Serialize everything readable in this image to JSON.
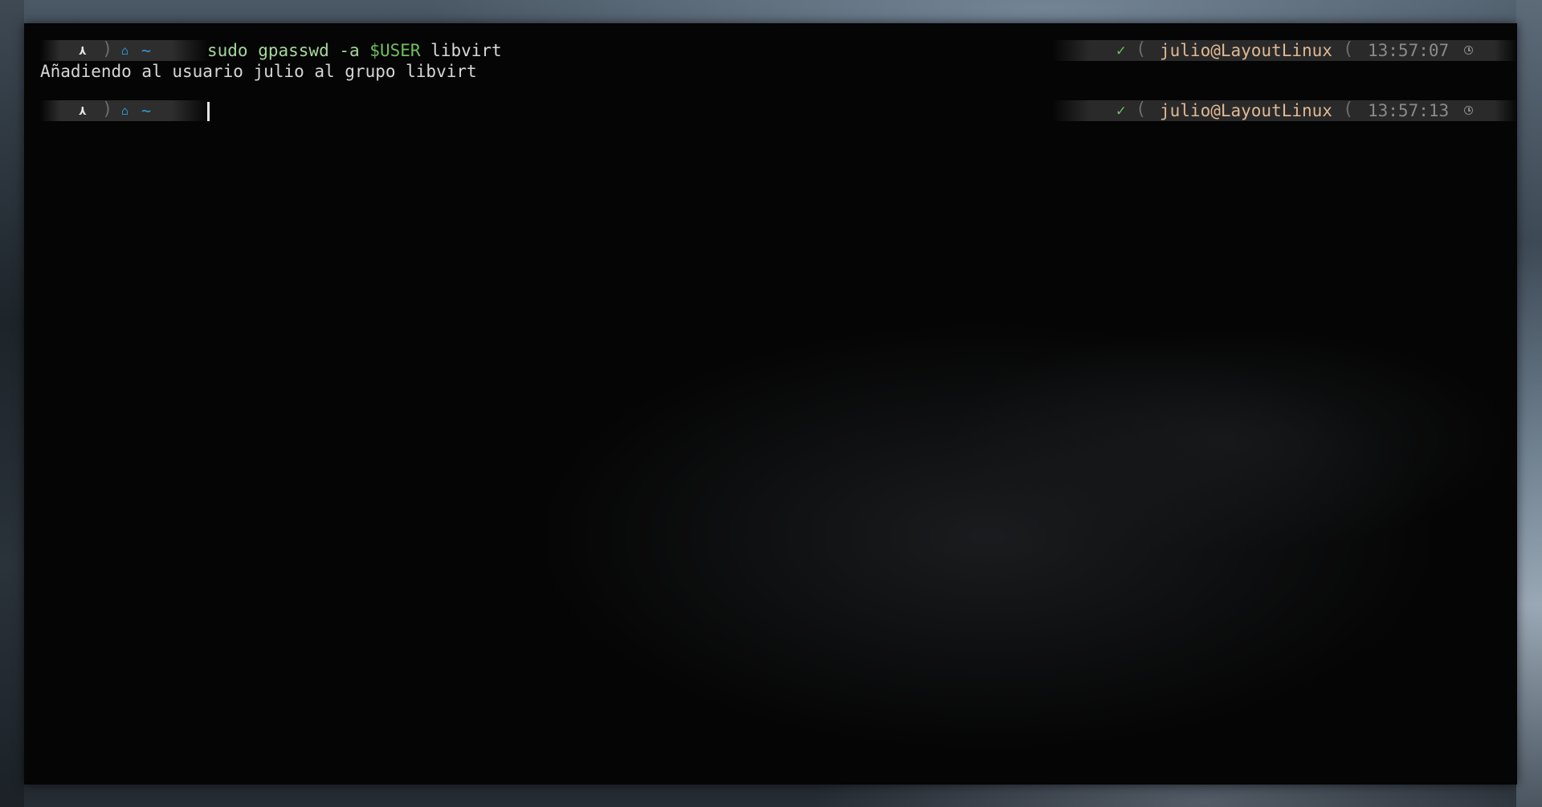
{
  "terminal": {
    "lines": [
      {
        "prompt": {
          "os_icon": "arch-icon",
          "os_glyph": "⋏",
          "separator": ")",
          "home_icon": "home-icon",
          "home_glyph": "⌂",
          "path": "~"
        },
        "command": {
          "name": "sudo gpasswd -a ",
          "variable": "$USER",
          "argument": " libvirt"
        },
        "right_prompt": {
          "status_icon": "check-icon",
          "status_glyph": "✓",
          "separator_open": "(",
          "user_host": "julio@LayoutLinux",
          "time": "13:57:07",
          "time_icon": "clock-icon"
        }
      },
      {
        "output": "Añadiendo al usuario julio al grupo libvirt"
      },
      {
        "prompt": {
          "os_icon": "arch-icon",
          "os_glyph": "⋏",
          "separator": ")",
          "home_icon": "home-icon",
          "home_glyph": "⌂",
          "path": "~"
        },
        "command": null,
        "right_prompt": {
          "status_icon": "check-icon",
          "status_glyph": "✓",
          "separator_open": "(",
          "user_host": "julio@LayoutLinux",
          "time": "13:57:13",
          "time_icon": "clock-icon"
        }
      }
    ]
  },
  "colors": {
    "terminal_bg": "#050505",
    "segment_bg": "#303030",
    "path_blue": "#2f9ad6",
    "command_green": "#a5d89a",
    "variable_green": "#6dc25b",
    "status_green": "#6dc25b",
    "user_host_tan": "#e0b894",
    "time_gray": "#8a8a8a",
    "text": "#d6d6d6"
  }
}
